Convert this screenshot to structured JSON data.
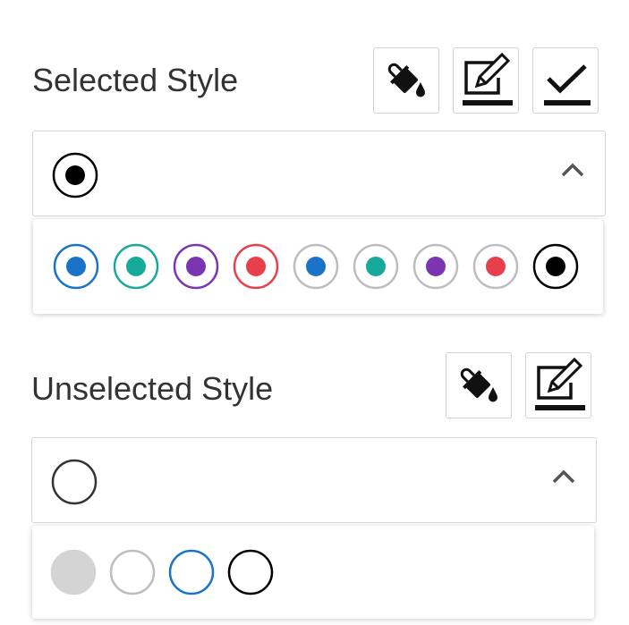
{
  "selected": {
    "title": "Selected Style",
    "tools": [
      {
        "name": "fill-color-button",
        "icon": "paint-bucket-icon"
      },
      {
        "name": "border-color-button",
        "icon": "edit-pencil-icon"
      },
      {
        "name": "check-color-button",
        "icon": "checkmark-icon"
      }
    ],
    "current": {
      "outer": "#000000",
      "inner": "#000000",
      "fill": "#ffffff"
    },
    "options": [
      {
        "name": "radio-style-blue-ring",
        "outer": "#1a73c8",
        "inner": "#1a73c8"
      },
      {
        "name": "radio-style-teal-ring",
        "outer": "#17a99a",
        "inner": "#17a99a"
      },
      {
        "name": "radio-style-purple-ring",
        "outer": "#7b35b0",
        "inner": "#7b35b0"
      },
      {
        "name": "radio-style-red-ring",
        "outer": "#e8404a",
        "inner": "#e8404a"
      },
      {
        "name": "radio-style-blue-gray-ring",
        "outer": "#bdbdbd",
        "inner": "#1a73c8"
      },
      {
        "name": "radio-style-teal-gray-ring",
        "outer": "#bdbdbd",
        "inner": "#17a99a"
      },
      {
        "name": "radio-style-purple-gray-ring",
        "outer": "#bdbdbd",
        "inner": "#7b35b0"
      },
      {
        "name": "radio-style-red-gray-ring",
        "outer": "#bdbdbd",
        "inner": "#e8404a"
      },
      {
        "name": "radio-style-black-ring",
        "outer": "#000000",
        "inner": "#000000"
      }
    ]
  },
  "unselected": {
    "title": "Unselected Style",
    "tools": [
      {
        "name": "fill-color-button",
        "icon": "paint-bucket-icon"
      },
      {
        "name": "border-color-button",
        "icon": "edit-pencil-icon"
      }
    ],
    "current": {
      "outer": "#333333",
      "fill": "#ffffff"
    },
    "options": [
      {
        "name": "radio-style-gray-filled",
        "outer": "#d4d4d4",
        "fill": "#d4d4d4"
      },
      {
        "name": "radio-style-light-gray-ring",
        "outer": "#bdbdbd",
        "fill": "#ffffff"
      },
      {
        "name": "radio-style-blue-empty-ring",
        "outer": "#1a73c8",
        "fill": "#ffffff"
      },
      {
        "name": "radio-style-black-empty-ring",
        "outer": "#000000",
        "fill": "#ffffff"
      }
    ]
  }
}
